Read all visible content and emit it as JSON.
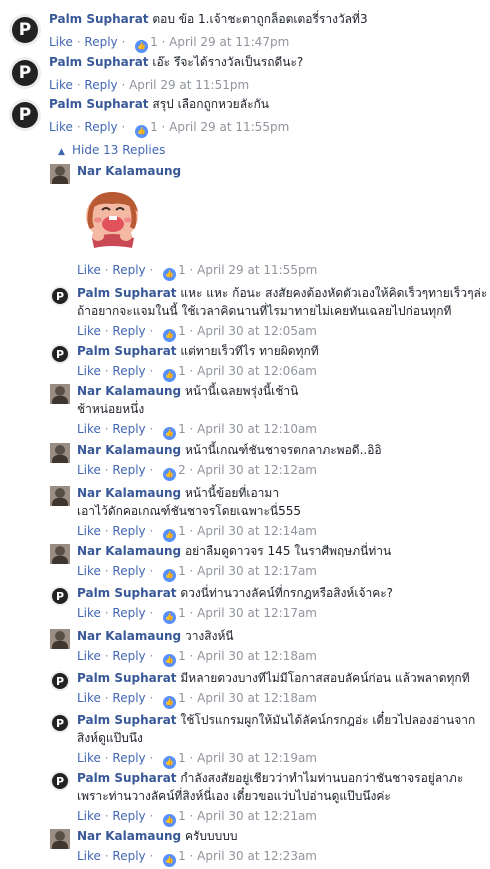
{
  "labels": {
    "like": "Like",
    "reply": "Reply",
    "hide_replies": "Hide 13 Replies"
  },
  "comments": [
    {
      "author": "Palm Supharat",
      "text": "ตอบ ข้อ 1.เจ้าชะตาถูกล็อตเตอรี่รางวัลที่3",
      "likes": "1",
      "time": "April 29 at 11:47pm"
    },
    {
      "author": "Palm Supharat",
      "text": "เอ๊ะ รึจะได้รางวัลเป็นรถดีนะ?",
      "likes": "",
      "time": "April 29 at 11:51pm"
    },
    {
      "author": "Palm Supharat",
      "text": "สรุป เลือกถูกหวยลัะกัน",
      "likes": "1",
      "time": "April 29 at 11:55pm"
    }
  ],
  "replies": [
    {
      "author": "Nar Kalamaung",
      "text": "",
      "text2": "",
      "likes": "1",
      "time": "April 29 at 11:55pm",
      "sticker": true
    },
    {
      "author": "Palm Supharat",
      "text": "แหะ แหะ ก้อนะ สงสัยคงต้องหัดตัวเองให้คิดเร็วๆทายเร็วๆล่ะ",
      "text2": "ถ้าอยากจะแจมในนี้ ใช้เวลาคิดนานที่ไรมาทายไม่เคยทันเฉลยไปก่อนทุกที",
      "likes": "1",
      "time": "April 30 at 12:05am"
    },
    {
      "author": "Palm Supharat",
      "text": "แต่ทายเร็วทีไร ทายผิดทุกที",
      "text2": "",
      "likes": "1",
      "time": "April 30 at 12:06am"
    },
    {
      "author": "Nar Kalamaung",
      "text": "หน้านี้เฉลยพรุ่งนี้เช้านิ",
      "text2": "ช้าหน่อยหนึ่ง",
      "likes": "1",
      "time": "April 30 at 12:10am"
    },
    {
      "author": "Nar Kalamaung",
      "text": "หน้านี้เกณฑ์ชันชาจรตกลาภะพอดี..อิอิ",
      "text2": "",
      "likes": "2",
      "time": "April 30 at 12:12am"
    },
    {
      "author": "Nar Kalamaung",
      "text": "หน้านี้ข้อยที่เอามา",
      "text2": "เอาไว้ดักคอเกณฑ์ชันชาจรโดยเฉพาะนี่555",
      "likes": "1",
      "time": "April 30 at 12:14am"
    },
    {
      "author": "Nar Kalamaung",
      "text": "อย่าลืมดูดาวจร 145 ในราศีพฤษภนี่ท่าน",
      "text2": "",
      "likes": "1",
      "time": "April 30 at 12:17am"
    },
    {
      "author": "Palm Supharat",
      "text": "ดวงนี่ท่านวางลัคน์ที่กรกฎหรือสิงห์เจ้าคะ?",
      "text2": "",
      "likes": "1",
      "time": "April 30 at 12:17am"
    },
    {
      "author": "Nar Kalamaung",
      "text": "วางสิงห์นี",
      "text2": "",
      "likes": "1",
      "time": "April 30 at 12:18am"
    },
    {
      "author": "Palm Supharat",
      "text": "มีหลายดวงบางทีไม่มีโอกาสสอบลัคน์ก่อน แล้วพลาดทุกที",
      "text2": "",
      "likes": "1",
      "time": "April 30 at 12:18am"
    },
    {
      "author": "Palm Supharat",
      "text": "ใช้โปรแกรมผูกให้มันได้ลัคน์กรกฎอ่ะ เดี๋ยวไปลองอ่านจาก",
      "text2": "สิงห์ดูแป๊บนึง",
      "likes": "1",
      "time": "April 30 at 12:19am"
    },
    {
      "author": "Palm Supharat",
      "text": "กำลังสงสัยอยู่เชียวว่าทำไมท่านบอกว่าชันชาจรอยู่ลาภะ",
      "text2": "เพราะท่านวางลัคน์ที่สิงห์นี่เอง เดี๋ยวขอแว่บไปอ่านดูแป๊บนึงค่ะ",
      "likes": "1",
      "time": "April 30 at 12:21am"
    },
    {
      "author": "Nar Kalamaung",
      "text": "ครับบบบบ",
      "text2": "",
      "likes": "1",
      "time": "April 30 at 12:23am"
    }
  ]
}
